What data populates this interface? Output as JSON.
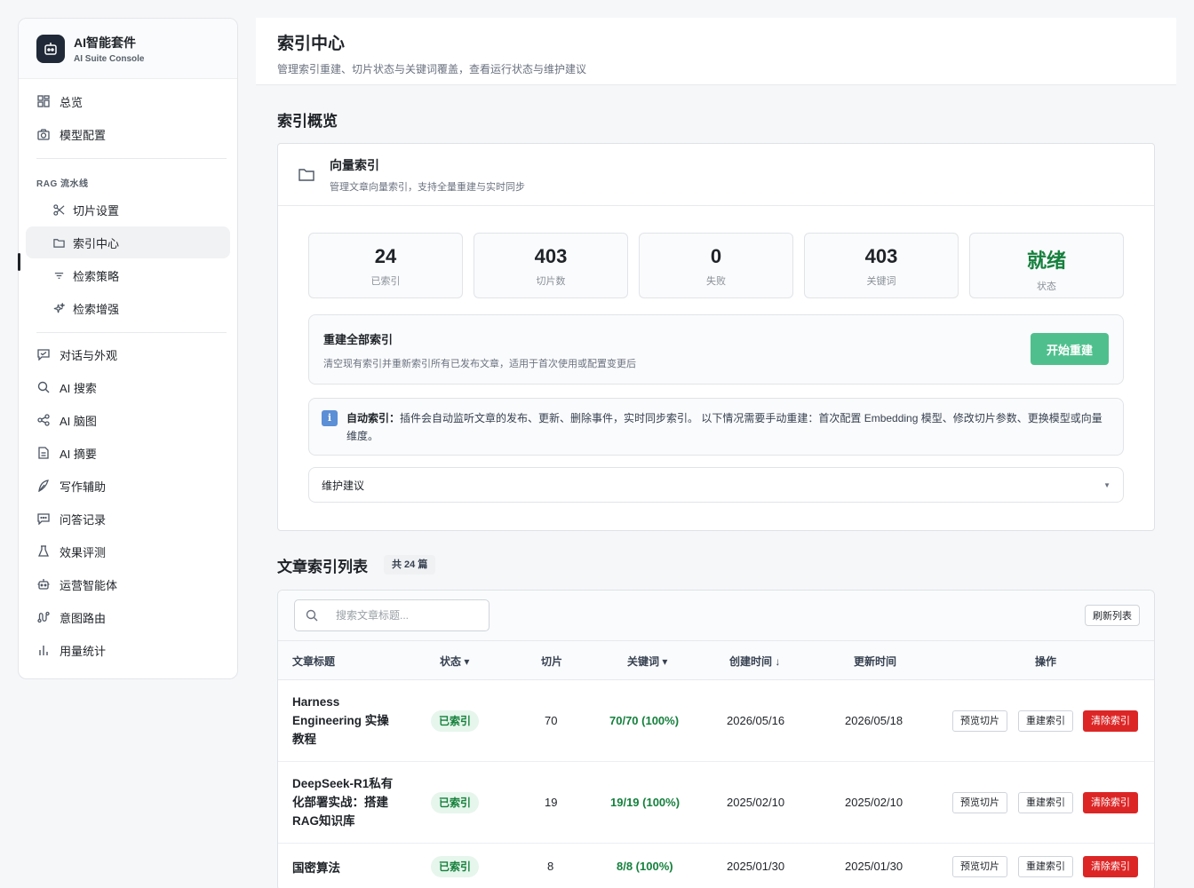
{
  "brand": {
    "title": "AI智能套件",
    "subtitle": "AI Suite Console"
  },
  "nav": {
    "overview": "总览",
    "model_config": "模型配置",
    "rag_section": "RAG 流水线",
    "chunk_settings": "切片设置",
    "index_center": "索引中心",
    "retrieval_strategy": "检索策略",
    "retrieval_enhance": "检索增强",
    "chat_appearance": "对话与外观",
    "ai_search": "AI 搜索",
    "ai_mindmap": "AI 脑图",
    "ai_summary": "AI 摘要",
    "writing_assist": "写作辅助",
    "qa_records": "问答记录",
    "evaluation": "效果评测",
    "ops_agent": "运营智能体",
    "intent_routing": "意图路由",
    "usage_stats": "用量统计"
  },
  "header": {
    "title": "索引中心",
    "desc": "管理索引重建、切片状态与关键词覆盖，查看运行状态与维护建议"
  },
  "overview": {
    "heading": "索引概览",
    "card_title": "向量索引",
    "card_desc": "管理文章向量索引，支持全量重建与实时同步",
    "stats": [
      {
        "value": "24",
        "label": "已索引"
      },
      {
        "value": "403",
        "label": "切片数"
      },
      {
        "value": "0",
        "label": "失败"
      },
      {
        "value": "403",
        "label": "关键词"
      },
      {
        "value": "就绪",
        "label": "状态"
      }
    ],
    "rebuild_title": "重建全部索引",
    "rebuild_desc": "清空现有索引并重新索引所有已发布文章，适用于首次使用或配置变更后",
    "rebuild_button": "开始重建",
    "info_icon": "i",
    "info_label": "自动索引：",
    "info_text": "插件会自动监听文章的发布、更新、删除事件，实时同步索引。 以下情况需要手动重建：首次配置 Embedding 模型、修改切片参数、更换模型或向量维度。",
    "maintenance": "维护建议"
  },
  "articles": {
    "heading": "文章索引列表",
    "count": "共 24 篇",
    "search_placeholder": "搜索文章标题...",
    "refresh": "刷新列表",
    "columns": {
      "title": "文章标题",
      "status": "状态 ▾",
      "chunks": "切片",
      "keywords": "关键词 ▾",
      "created": "创建时间 ↓",
      "updated": "更新时间",
      "actions": "操作"
    },
    "rows": [
      {
        "title": "Harness Engineering 实操教程",
        "status": "已索引",
        "chunks": "70",
        "keywords": "70/70 (100%)",
        "created": "2026/05/16",
        "updated": "2026/05/18"
      },
      {
        "title": "DeepSeek-R1私有化部署实战：搭建RAG知识库",
        "status": "已索引",
        "chunks": "19",
        "keywords": "19/19 (100%)",
        "created": "2025/02/10",
        "updated": "2025/02/10"
      },
      {
        "title": "国密算法",
        "status": "已索引",
        "chunks": "8",
        "keywords": "8/8 (100%)",
        "created": "2025/01/30",
        "updated": "2025/01/30"
      }
    ],
    "actions": {
      "preview": "预览切片",
      "reindex": "重建索引",
      "clear": "清除索引"
    }
  }
}
